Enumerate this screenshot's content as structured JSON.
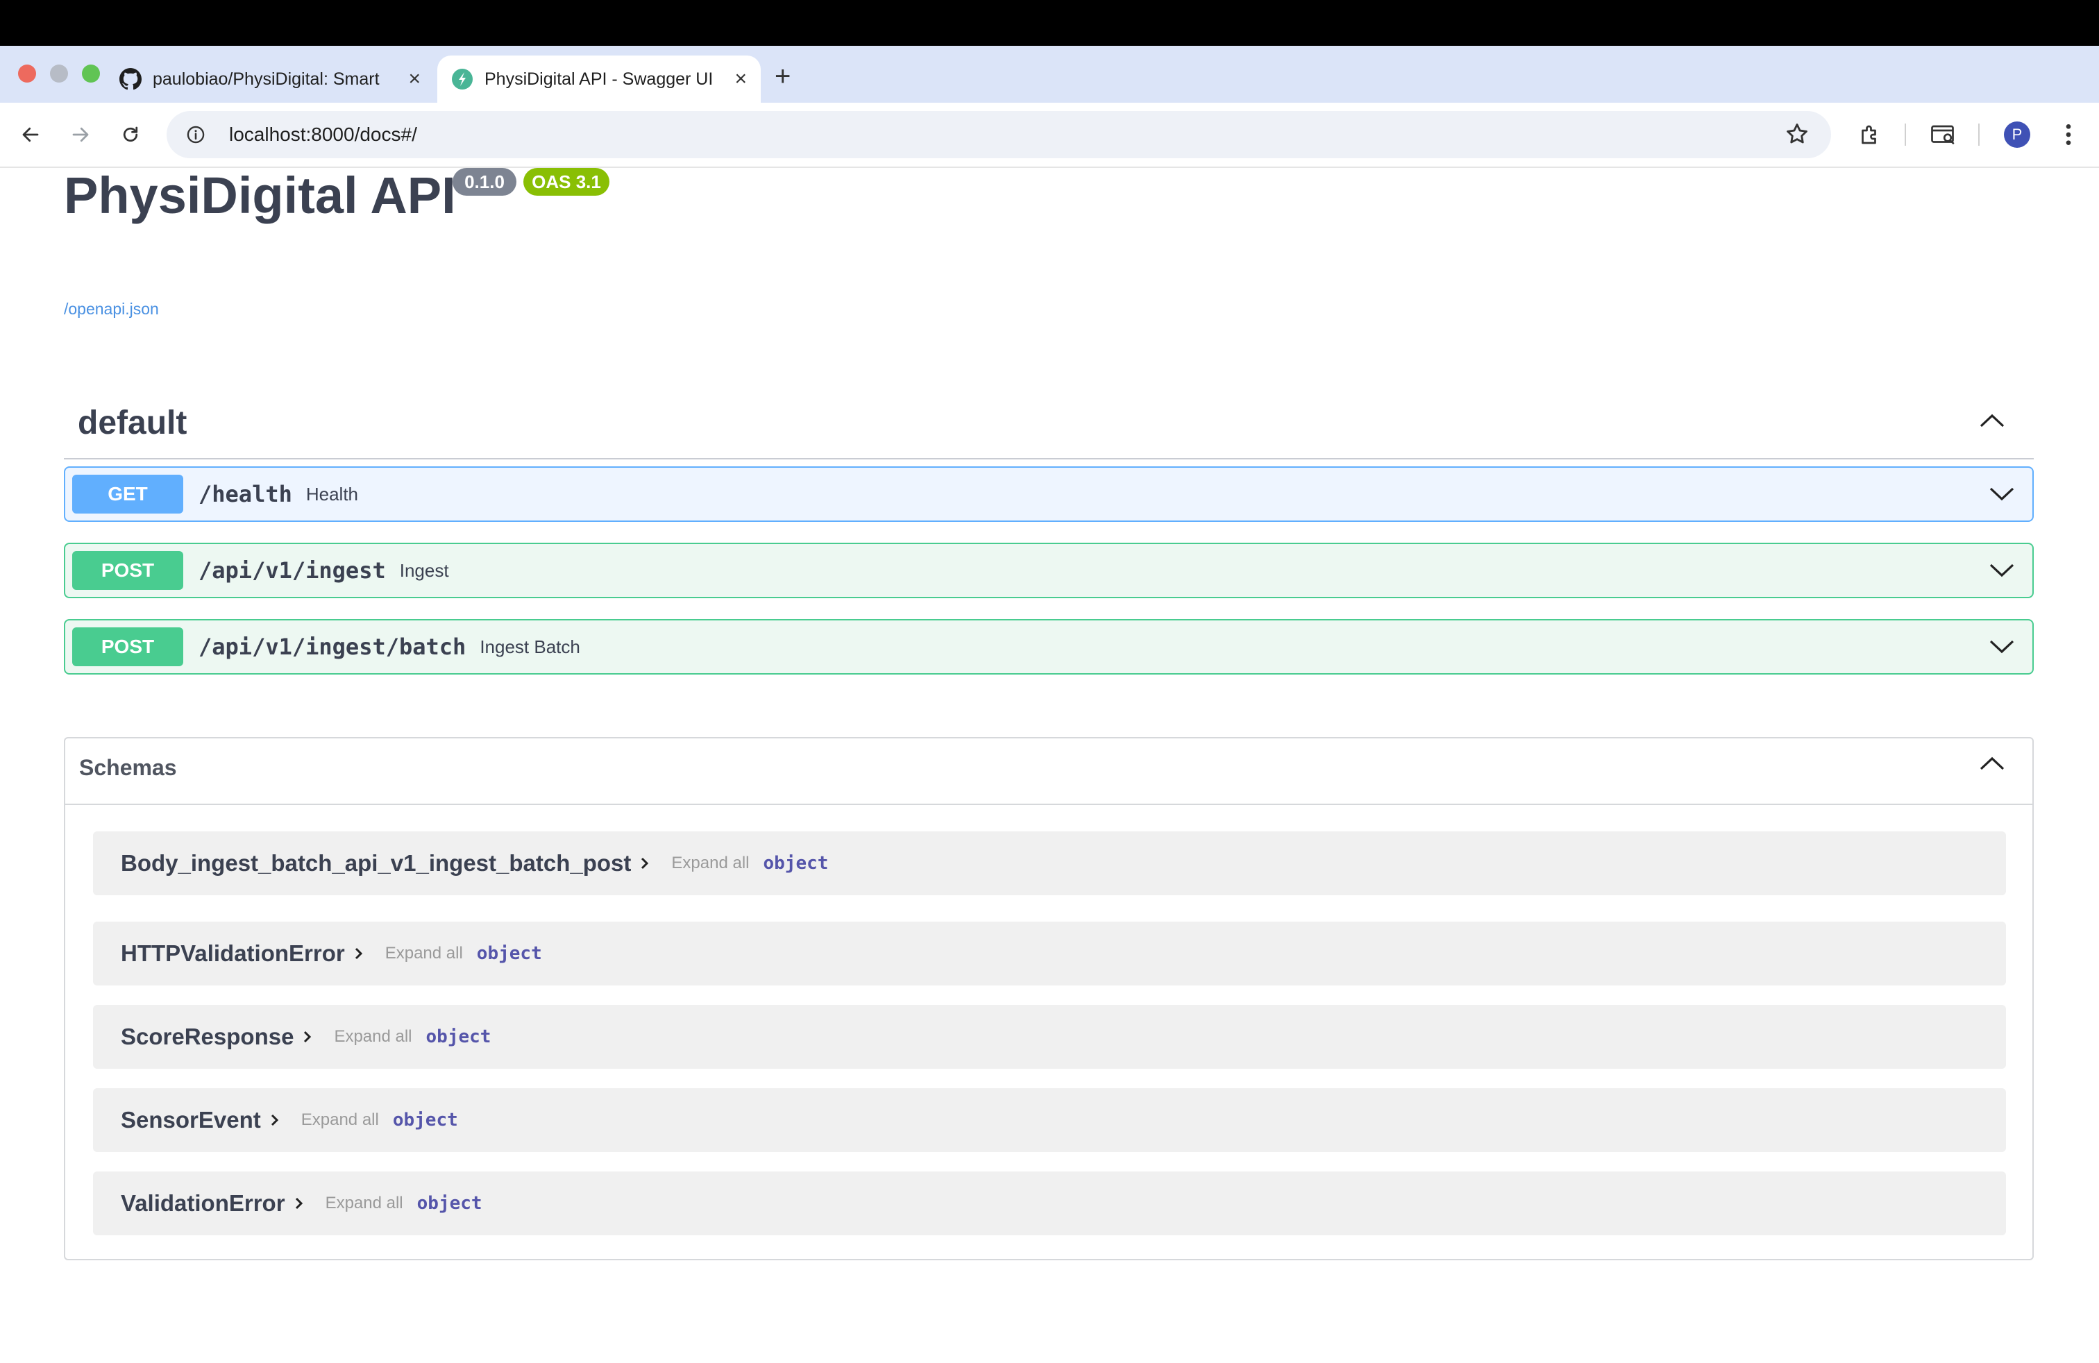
{
  "browser": {
    "tabs": [
      {
        "title": "paulobiao/PhysiDigital: Smart",
        "icon": "github-icon"
      },
      {
        "title": "PhysiDigital API - Swagger UI",
        "icon": "swagger-icon"
      }
    ],
    "new_tab": "+",
    "close": "×",
    "url": "localhost:8000/docs#/",
    "profile_initial": "P"
  },
  "api": {
    "title": "PhysiDigital API",
    "version": "0.1.0",
    "oas": "OAS 3.1",
    "spec_link": "/openapi.json"
  },
  "section": {
    "name": "default",
    "operations": [
      {
        "method": "GET",
        "path": "/health",
        "summary": "Health"
      },
      {
        "method": "POST",
        "path": "/api/v1/ingest",
        "summary": "Ingest"
      },
      {
        "method": "POST",
        "path": "/api/v1/ingest/batch",
        "summary": "Ingest Batch"
      }
    ]
  },
  "schemas": {
    "title": "Schemas",
    "expand_label": "Expand all",
    "items": [
      {
        "name": "Body_ingest_batch_api_v1_ingest_batch_post",
        "type": "object"
      },
      {
        "name": "HTTPValidationError",
        "type": "object"
      },
      {
        "name": "ScoreResponse",
        "type": "object"
      },
      {
        "name": "SensorEvent",
        "type": "object"
      },
      {
        "name": "ValidationError",
        "type": "object"
      }
    ]
  },
  "colors": {
    "get": "#61affe",
    "post": "#49cc90",
    "version_badge": "#7d8492",
    "oas_badge": "#89bf04"
  }
}
